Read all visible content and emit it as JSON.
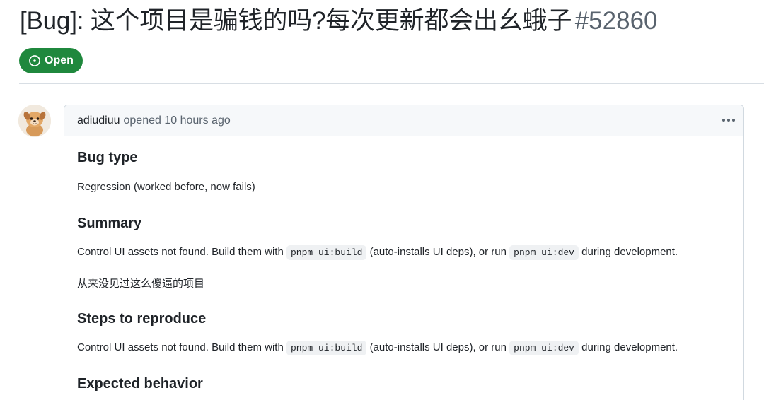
{
  "issue": {
    "title": "[Bug]: 这个项目是骗钱的吗?每次更新都会出幺蛾子",
    "number": "#52860",
    "state": "Open",
    "state_color": "#1f883d"
  },
  "comment": {
    "author": "adiudiuu",
    "meta": "opened 10 hours ago",
    "more_icon": "kebab-horizontal-icon",
    "sections": {
      "bug_type": {
        "heading": "Bug type",
        "text": "Regression (worked before, now fails)"
      },
      "summary": {
        "heading": "Summary",
        "text_a": "Control UI assets not found. Build them with",
        "code_a": "pnpm ui:build",
        "text_b": "(auto-installs UI deps), or run",
        "code_b": "pnpm ui:dev",
        "text_c": "during development.",
        "extra": "从来没见过这么傻逼的项目"
      },
      "steps": {
        "heading": "Steps to reproduce",
        "text_a": "Control UI assets not found. Build them with",
        "code_a": "pnpm ui:build",
        "text_b": "(auto-installs UI deps), or run",
        "code_b": "pnpm ui:dev",
        "text_c": "during development."
      },
      "expected": {
        "heading": "Expected behavior"
      }
    }
  }
}
